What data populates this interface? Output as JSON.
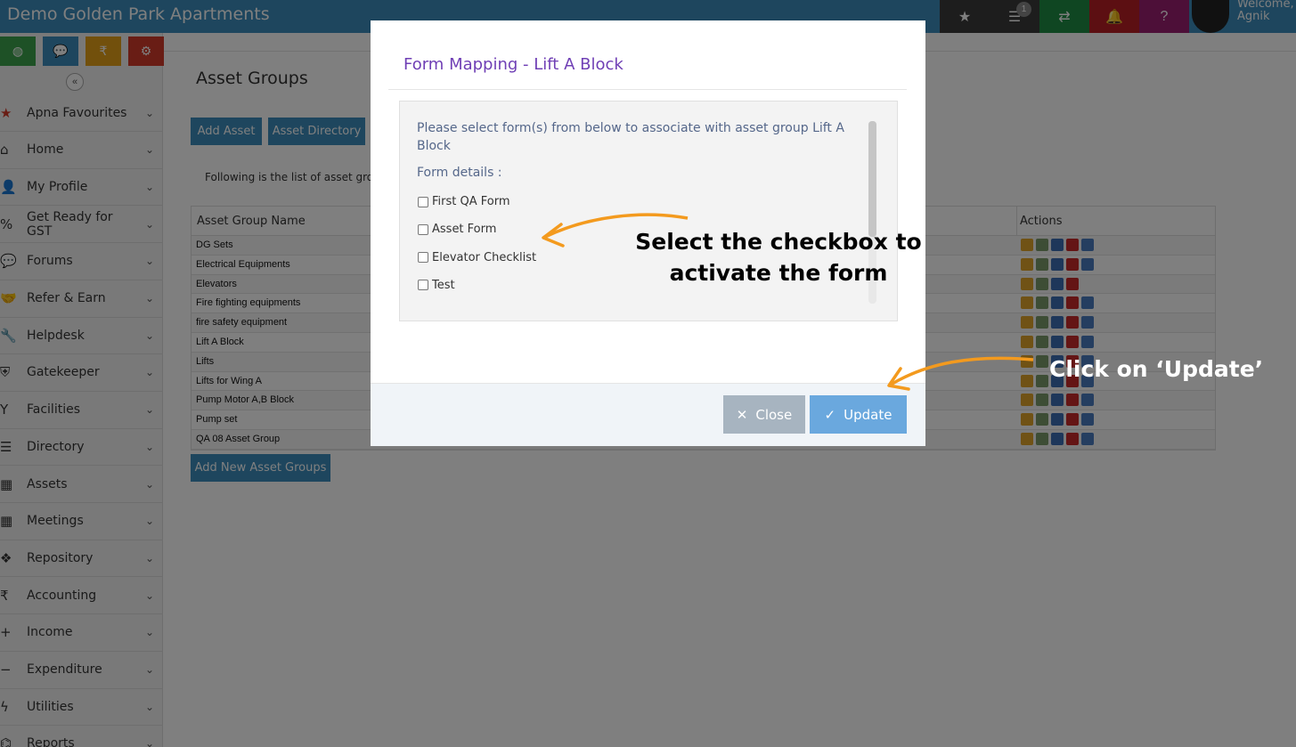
{
  "app": {
    "title": "Demo Golden Park Apartments"
  },
  "header": {
    "icons": [
      {
        "name": "star-icon",
        "glyph": "★",
        "color": "#3a3a3a"
      },
      {
        "name": "list-icon",
        "glyph": "☰",
        "color": "#3a3a3a"
      },
      {
        "name": "shuffle-icon",
        "glyph": "⇄",
        "color": "#1e8c44"
      },
      {
        "name": "bell-icon",
        "glyph": "🔔",
        "color": "#b81f24"
      },
      {
        "name": "help-icon",
        "glyph": "?",
        "color": "#9b1e70"
      }
    ],
    "badge_count": "1",
    "welcome": "Welcome,",
    "user": "Agnik"
  },
  "sidebar": {
    "quick": [
      {
        "name": "dashboard-icon",
        "glyph": "◍",
        "color": "#3ca34d"
      },
      {
        "name": "chat-icon",
        "glyph": "💬",
        "color": "#3c8dbc"
      },
      {
        "name": "rupee-icon",
        "glyph": "₹",
        "color": "#e4a019"
      },
      {
        "name": "settings-icon",
        "glyph": "⚙",
        "color": "#d23b2a"
      }
    ],
    "collapse_glyph": "«",
    "items": [
      {
        "label": "Apna Favourites",
        "icon": "★",
        "icon_name": "star-icon"
      },
      {
        "label": "Home",
        "icon": "⌂",
        "icon_name": "home-icon"
      },
      {
        "label": "My Profile",
        "icon": "👤",
        "icon_name": "user-icon"
      },
      {
        "label": "Get Ready for GST",
        "icon": "%",
        "icon_name": "percent-icon"
      },
      {
        "label": "Forums",
        "icon": "💬",
        "icon_name": "comments-icon"
      },
      {
        "label": "Refer & Earn",
        "icon": "🤝",
        "icon_name": "handshake-icon"
      },
      {
        "label": "Helpdesk",
        "icon": "🔧",
        "icon_name": "wrench-icon"
      },
      {
        "label": "Gatekeeper",
        "icon": "⛨",
        "icon_name": "shield-icon"
      },
      {
        "label": "Facilities",
        "icon": "Y",
        "icon_name": "cocktail-icon"
      },
      {
        "label": "Directory",
        "icon": "☰",
        "icon_name": "list-icon"
      },
      {
        "label": "Assets",
        "icon": "▦",
        "icon_name": "building-icon"
      },
      {
        "label": "Meetings",
        "icon": "▦",
        "icon_name": "calendar-icon"
      },
      {
        "label": "Repository",
        "icon": "❖",
        "icon_name": "dropbox-icon"
      },
      {
        "label": "Accounting",
        "icon": "₹",
        "icon_name": "rupee-icon"
      },
      {
        "label": "Income",
        "icon": "+",
        "icon_name": "plus-icon"
      },
      {
        "label": "Expenditure",
        "icon": "−",
        "icon_name": "minus-icon"
      },
      {
        "label": "Utilities",
        "icon": "ϟ",
        "icon_name": "bolt-icon"
      },
      {
        "label": "Reports",
        "icon": "⌬",
        "icon_name": "chart-icon"
      }
    ]
  },
  "main": {
    "title": "Asset Groups",
    "add_asset": "Add Asset",
    "asset_directory": "Asset Directory",
    "intro": "Following is the list of asset groups",
    "col_name": "Asset Group Name",
    "col_actions": "Actions",
    "rows": [
      "DG Sets",
      "Electrical Equipments",
      "Elevators",
      "Fire fighting equipments",
      "fire safety equipment",
      "Lift A Block",
      "Lifts",
      "Lifts for Wing A",
      "Pump Motor A,B Block",
      "Pump set",
      "QA 08 Asset Group"
    ],
    "add_new": "Add New Asset Groups"
  },
  "modal": {
    "title": "Form Mapping - Lift A Block",
    "description": "Please select form(s) from below to associate with asset group Lift A Block",
    "form_details": "Form details :",
    "forms": [
      "First QA Form",
      "Asset Form",
      "Elevator Checklist",
      "Test"
    ],
    "close": "Close",
    "update": "Update"
  },
  "annotations": {
    "select_line1": "Select the checkbox to",
    "select_line2": "activate the form",
    "click_update": "Click on ‘Update’",
    "arrow_color": "#f39a1e"
  }
}
